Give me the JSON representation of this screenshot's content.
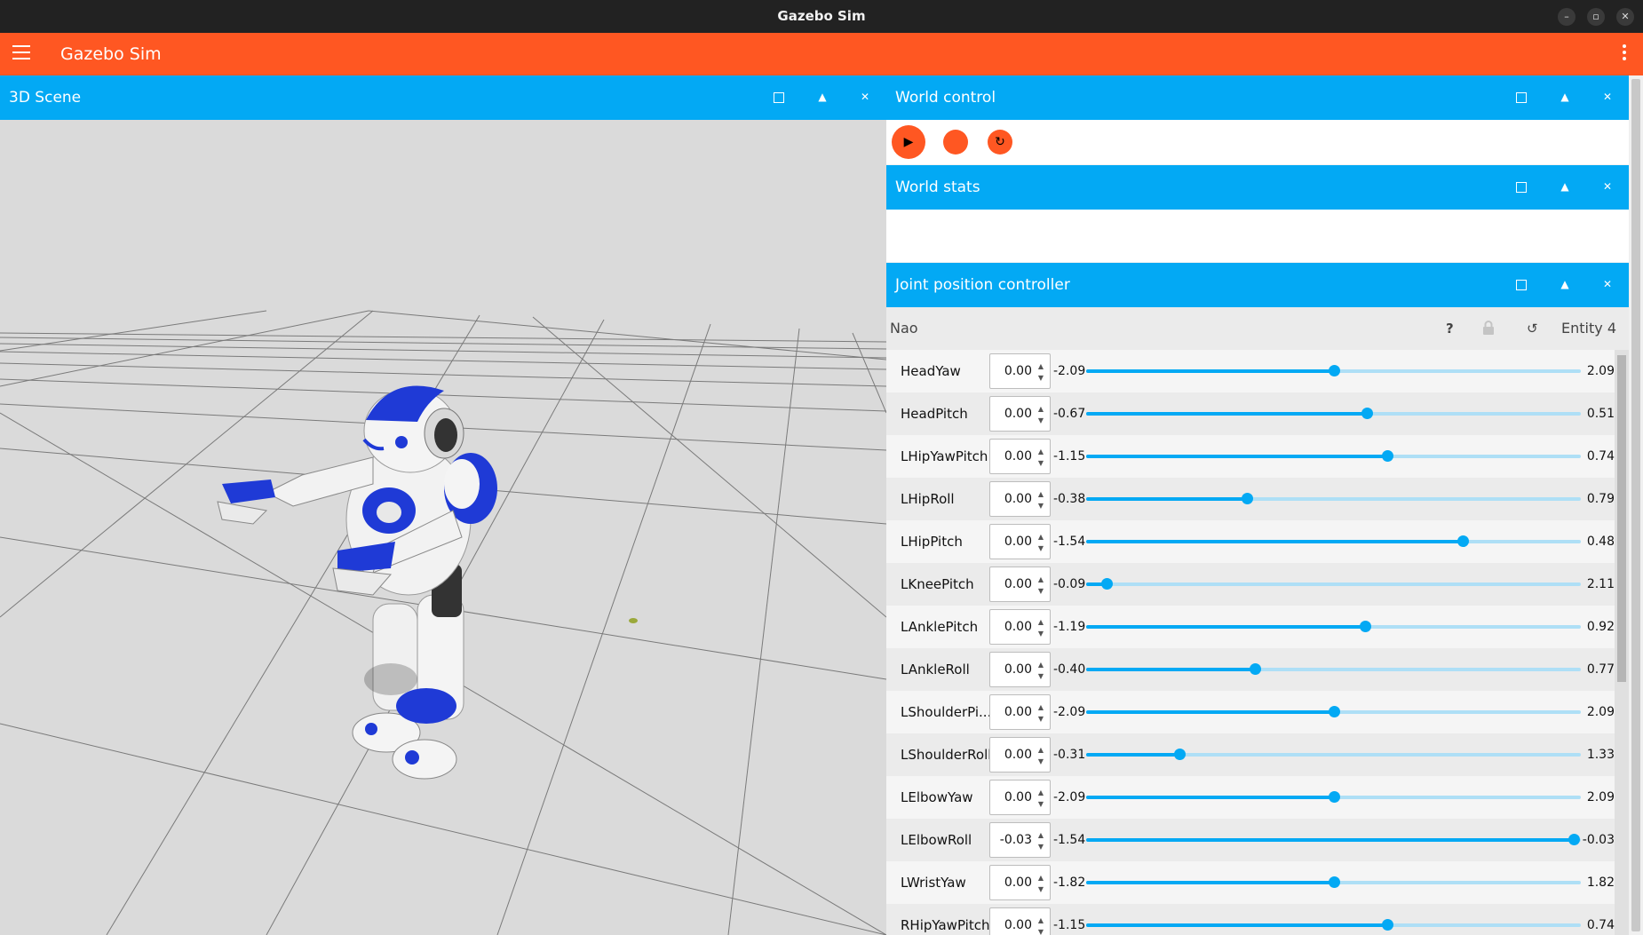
{
  "window": {
    "title": "Gazebo Sim"
  },
  "appbar": {
    "title": "Gazebo Sim"
  },
  "scene_panel": {
    "title": "3D Scene"
  },
  "world_control": {
    "title": "World control"
  },
  "world_stats": {
    "title": "World stats"
  },
  "joint_panel": {
    "title": "Joint position controller",
    "model_name": "Nao",
    "help_label": "?",
    "entity_label": "Entity 4",
    "joints": [
      {
        "name": "HeadYaw",
        "value": "0.00",
        "min": "-2.09",
        "max": "2.09",
        "fraction": 0.5
      },
      {
        "name": "HeadPitch",
        "value": "0.00",
        "min": "-0.67",
        "max": "0.51",
        "fraction": 0.567
      },
      {
        "name": "LHipYawPitch",
        "value": "0.00",
        "min": "-1.15",
        "max": "0.74",
        "fraction": 0.608
      },
      {
        "name": "LHipRoll",
        "value": "0.00",
        "min": "-0.38",
        "max": "0.79",
        "fraction": 0.325
      },
      {
        "name": "LHipPitch",
        "value": "0.00",
        "min": "-1.54",
        "max": "0.48",
        "fraction": 0.762
      },
      {
        "name": "LKneePitch",
        "value": "0.00",
        "min": "-0.09",
        "max": "2.11",
        "fraction": 0.041
      },
      {
        "name": "LAnklePitch",
        "value": "0.00",
        "min": "-1.19",
        "max": "0.92",
        "fraction": 0.564
      },
      {
        "name": "LAnkleRoll",
        "value": "0.00",
        "min": "-0.40",
        "max": "0.77",
        "fraction": 0.342
      },
      {
        "name": "LShoulderPi...",
        "value": "0.00",
        "min": "-2.09",
        "max": "2.09",
        "fraction": 0.5
      },
      {
        "name": "LShoulderRoll",
        "value": "0.00",
        "min": "-0.31",
        "max": "1.33",
        "fraction": 0.189
      },
      {
        "name": "LElbowYaw",
        "value": "0.00",
        "min": "-2.09",
        "max": "2.09",
        "fraction": 0.5
      },
      {
        "name": "LElbowRoll",
        "value": "-0.03",
        "min": "-1.54",
        "max": "-0.03",
        "fraction": 0.985
      },
      {
        "name": "LWristYaw",
        "value": "0.00",
        "min": "-1.82",
        "max": "1.82",
        "fraction": 0.5
      },
      {
        "name": "RHipYawPitch",
        "value": "0.00",
        "min": "-1.15",
        "max": "0.74",
        "fraction": 0.608
      }
    ]
  },
  "colors": {
    "accent_orange": "#ff5722",
    "accent_blue": "#03a9f4",
    "robot_blue": "#1f3ad6",
    "scene_bg": "#dadada"
  },
  "icons": {
    "menu": "hamburger-icon",
    "kebab": "more-vert-icon",
    "play": "play-icon",
    "step": "step-icon",
    "reset": "refresh-icon",
    "lock": "lock-icon",
    "refresh": "reset-icon"
  }
}
